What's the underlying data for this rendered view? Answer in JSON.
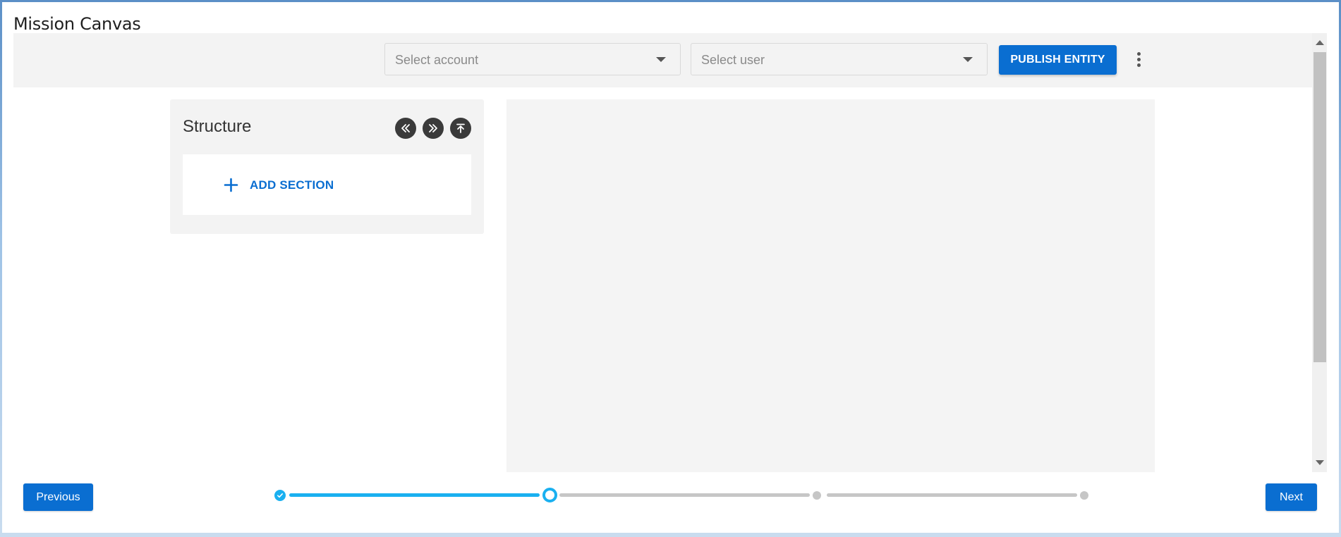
{
  "window": {
    "title": "Mission Canvas"
  },
  "toolbar": {
    "account_select": {
      "placeholder": "Select account"
    },
    "user_select": {
      "placeholder": "Select user"
    },
    "publish_label": "PUBLISH ENTITY",
    "more_icon": "more-vertical-icon"
  },
  "structure": {
    "title": "Structure",
    "icons": [
      "collapse-all-icon",
      "expand-all-icon",
      "scroll-to-top-icon"
    ],
    "add_section_label": "ADD SECTION"
  },
  "footer": {
    "previous_label": "Previous",
    "next_label": "Next"
  },
  "stepper": {
    "total_steps": 4,
    "current_step": 2,
    "completed_steps": 1
  },
  "colors": {
    "primary": "#0a6ed1",
    "step_active": "#1ab0f0",
    "step_inactive": "#c6c6c6",
    "panel_bg": "#f3f3f3"
  }
}
